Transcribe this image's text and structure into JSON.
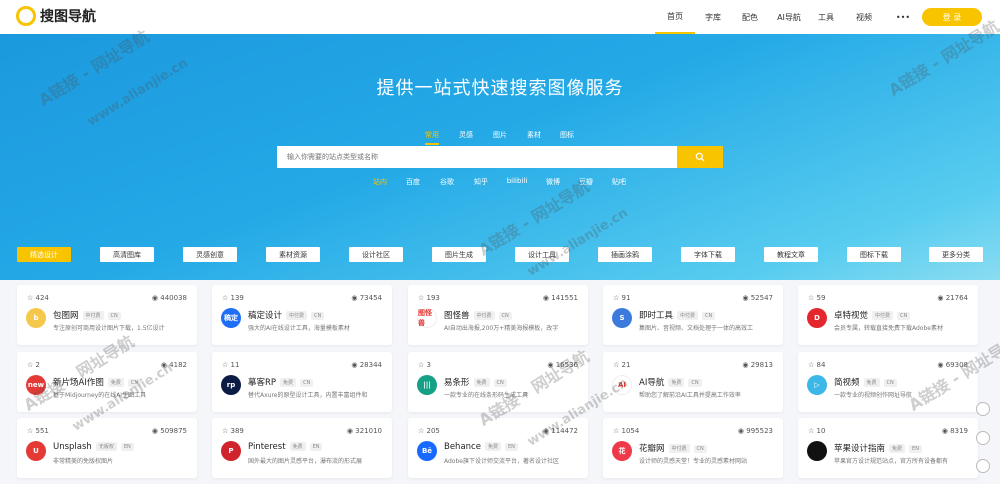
{
  "header": {
    "logo": "搜图导航",
    "nav": [
      "首页",
      "字库",
      "配色",
      "AI导航",
      "工具",
      "视频"
    ],
    "more": "•••",
    "login": "登 录"
  },
  "hero": {
    "title": "提供一站式快速搜索图像服务",
    "tabs": [
      "常用",
      "灵感",
      "图片",
      "素材",
      "图标"
    ],
    "placeholder": "输入你需要的站点类型或名称",
    "engines": [
      "站内",
      "百度",
      "谷歌",
      "知乎",
      "bilibili",
      "微博",
      "豆瓣",
      "贴吧"
    ]
  },
  "categories": [
    "精选设计",
    "高清图库",
    "灵感创意",
    "素材资源",
    "设计社区",
    "图片生成",
    "设计工具",
    "插画涂鸦",
    "字体下载",
    "教程文章",
    "图标下载",
    "更多分类"
  ],
  "cards": [
    {
      "likes": "424",
      "views": "440038",
      "name": "包图网",
      "tags": [
        "中付费",
        "CN"
      ],
      "desc": "专注原创可商用设计图片下载，1.5亿设计",
      "icon_color": "#f5c84c",
      "icon_text": "b"
    },
    {
      "likes": "139",
      "views": "73454",
      "name": "稿定设计",
      "tags": [
        "中付费",
        "CN"
      ],
      "desc": "强大的AI在线设计工具，海量模板素材",
      "icon_color": "#1e6ff5",
      "icon_text": "稿定"
    },
    {
      "likes": "193",
      "views": "141551",
      "name": "图怪兽",
      "tags": [
        "中付费",
        "CN"
      ],
      "desc": "AI自动出海报,200万+精美海报模板，改字",
      "icon_color": "#ffffff",
      "icon_text": "图怪兽"
    },
    {
      "likes": "91",
      "views": "52547",
      "name": "即时工具",
      "tags": [
        "中付费",
        "CN"
      ],
      "desc": "集图片、音视频、文档处理于一体的高效工",
      "icon_color": "#3c7bdc",
      "icon_text": "S"
    },
    {
      "likes": "59",
      "views": "21764",
      "name": "卓特视觉",
      "tags": [
        "中付费",
        "CN"
      ],
      "desc": "会员专属，转载直接免费下载Adobe素材",
      "icon_color": "#e4262d",
      "icon_text": "D"
    },
    {
      "likes": "2",
      "views": "4182",
      "name": "新片场AI作图",
      "tags": [
        "免费",
        "CN"
      ],
      "desc": "基于Midjourney的在线AI生图工具",
      "icon_color": "#e53935",
      "icon_text": "new"
    },
    {
      "likes": "11",
      "views": "28344",
      "name": "摹客RP",
      "tags": [
        "免费",
        "CN"
      ],
      "desc": "替代Axure的原型设计工具，内置丰富组件和",
      "icon_color": "#0b1b44",
      "icon_text": "rp"
    },
    {
      "likes": "3",
      "views": "16536",
      "name": "易条形",
      "tags": [
        "免费",
        "CN"
      ],
      "desc": "一款专业的在线条形码生成工具",
      "icon_color": "#16a085",
      "icon_text": "|||"
    },
    {
      "likes": "21",
      "views": "29813",
      "name": "AI导航",
      "tags": [
        "免费",
        "CN"
      ],
      "desc": "帮助您了解前沿AI工具并提高工作效率",
      "icon_color": "#ffffff",
      "icon_text": "AI"
    },
    {
      "likes": "84",
      "views": "69308",
      "name": "简视频",
      "tags": [
        "免费",
        "CN"
      ],
      "desc": "一款专业的视频创作网址导航",
      "icon_color": "#3cb8e8",
      "icon_text": "▷"
    },
    {
      "likes": "551",
      "views": "509875",
      "name": "Unsplash",
      "tags": [
        "无版权",
        "EN"
      ],
      "desc": "非常精美的免版权图片",
      "icon_color": "#e53935",
      "icon_text": "U"
    },
    {
      "likes": "389",
      "views": "321010",
      "name": "Pinterest",
      "tags": [
        "免费",
        "EN"
      ],
      "desc": "国外最大的图片灵感平台，瀑布流的形式展",
      "icon_color": "#d0232b",
      "icon_text": "P"
    },
    {
      "likes": "205",
      "views": "114472",
      "name": "Behance",
      "tags": [
        "免费",
        "EN"
      ],
      "desc": "Adobe旗下设计师交流平台，著名设计社区",
      "icon_color": "#1769ff",
      "icon_text": "Bē"
    },
    {
      "likes": "1054",
      "views": "995523",
      "name": "花瓣网",
      "tags": [
        "中付费",
        "CN"
      ],
      "desc": "设计师的灵感天堂！专业的灵感素材网站",
      "icon_color": "#ee3a48",
      "icon_text": "花"
    },
    {
      "likes": "10",
      "views": "8319",
      "name": "苹果设计指南",
      "tags": [
        "免费",
        "EN"
      ],
      "desc": "苹果官方设计规范站点，官方所有设备都有",
      "icon_color": "#111111",
      "icon_text": ""
    }
  ],
  "watermark": [
    "A链接 - 网址导航",
    "www.alianjie.cn"
  ]
}
